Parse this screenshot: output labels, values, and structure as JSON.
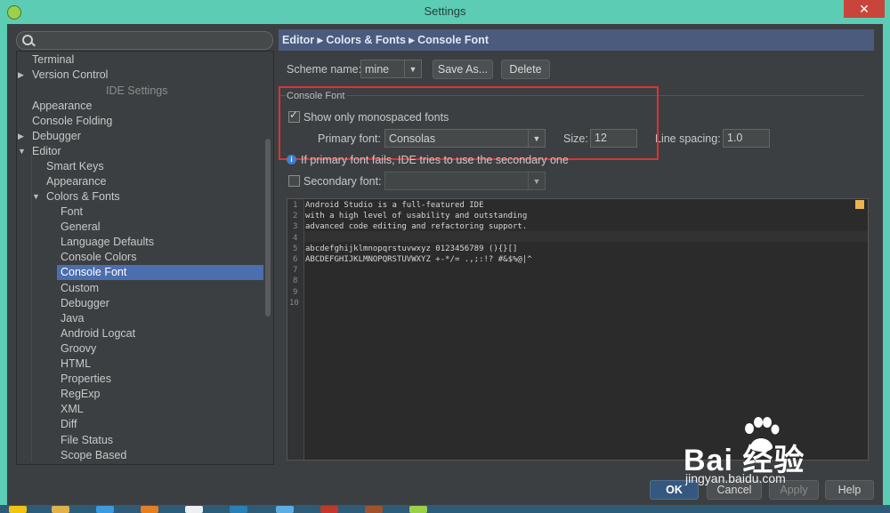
{
  "window": {
    "title": "Settings",
    "close_glyph": "✕"
  },
  "sidebar": {
    "search_placeholder": "",
    "section_header": "IDE Settings",
    "items_top": [
      {
        "label": "Terminal"
      },
      {
        "label": "Version Control"
      }
    ],
    "items_ide": [
      {
        "label": "Appearance"
      },
      {
        "label": "Console Folding"
      },
      {
        "label": "Debugger"
      },
      {
        "label": "Editor"
      }
    ],
    "editor_children": [
      {
        "label": "Smart Keys"
      },
      {
        "label": "Appearance"
      },
      {
        "label": "Colors & Fonts"
      }
    ],
    "colors_children": [
      {
        "label": "Font"
      },
      {
        "label": "General"
      },
      {
        "label": "Language Defaults"
      },
      {
        "label": "Console Colors"
      },
      {
        "label": "Console Font",
        "selected": true
      },
      {
        "label": "Custom"
      },
      {
        "label": "Debugger"
      },
      {
        "label": "Java"
      },
      {
        "label": "Android Logcat"
      },
      {
        "label": "Groovy"
      },
      {
        "label": "HTML"
      },
      {
        "label": "Properties"
      },
      {
        "label": "RegExp"
      },
      {
        "label": "XML"
      },
      {
        "label": "Diff"
      },
      {
        "label": "File Status"
      },
      {
        "label": "Scope Based"
      }
    ]
  },
  "breadcrumb": {
    "text": "Editor ▸ Colors & Fonts ▸ Console Font"
  },
  "scheme": {
    "label": "Scheme name:",
    "value": "mine",
    "save_as": "Save As...",
    "delete": "Delete"
  },
  "console_font": {
    "group_title": "Console Font",
    "mono_only_label": "Show only monospaced fonts",
    "mono_only_checked": true,
    "primary_label": "Primary font:",
    "primary_value": "Consolas",
    "size_label": "Size:",
    "size_value": "12",
    "spacing_label": "Line spacing:",
    "spacing_value": "1.0",
    "info_text": "If primary font fails, IDE tries to use the secondary one",
    "secondary_label": "Secondary font:",
    "secondary_value": "",
    "secondary_checked": false
  },
  "preview": {
    "line_numbers": [
      "1",
      "2",
      "3",
      "4",
      "5",
      "6",
      "7",
      "8",
      "9",
      "10"
    ],
    "lines": [
      "Android Studio is a full-featured IDE",
      "with a high level of usability and outstanding",
      "advanced code editing and refactoring support.",
      "",
      "abcdefghijklmnopqrstuvwxyz 0123456789 (){}[]",
      "ABCDEFGHIJKLMNOPQRSTUVWXYZ +-*/= .,;:!? #&$%@|^"
    ]
  },
  "footer": {
    "ok": "OK",
    "cancel": "Cancel",
    "apply": "Apply",
    "help": "Help"
  },
  "watermark": {
    "brand": "Bai  经验",
    "url": "jingyan.baidu.com"
  },
  "colors": {
    "title_bar": "#5ccdb4",
    "selection": "#4b6eaf",
    "breadcrumb_bg": "#4b5b7e",
    "highlight_box": "#d93434"
  }
}
